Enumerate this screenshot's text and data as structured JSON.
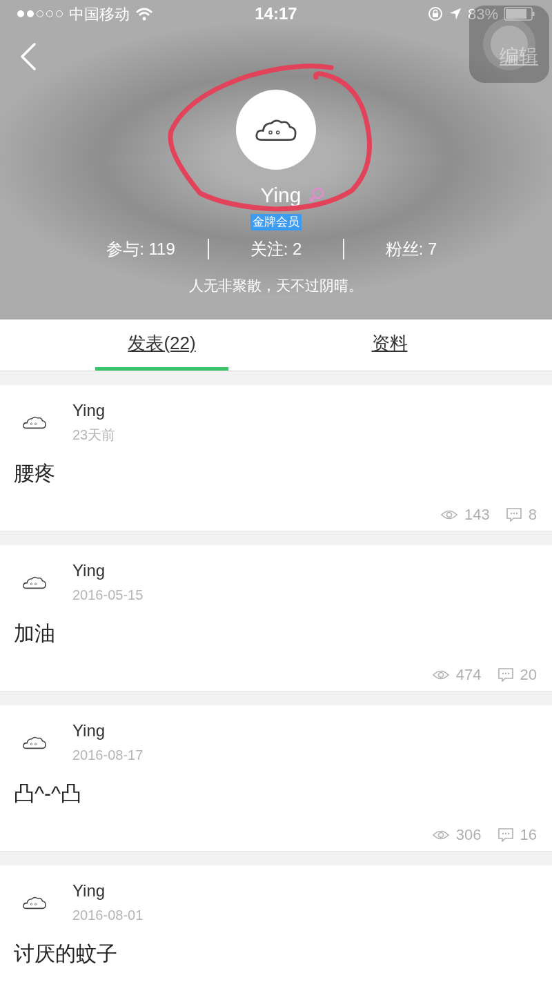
{
  "status_bar": {
    "carrier": "中国移动",
    "time": "14:17",
    "battery": "83%"
  },
  "header": {
    "edit": "编辑",
    "name": "Ying",
    "badge": "金牌会员",
    "motto": "人无非聚散，天不过阴晴。",
    "stats": [
      {
        "label": "参与: 119"
      },
      {
        "label": "关注: 2"
      },
      {
        "label": "粉丝: 7"
      }
    ]
  },
  "tabs": [
    {
      "label": "发表(22)",
      "selected": true
    },
    {
      "label": "资料",
      "selected": false
    }
  ],
  "posts": [
    {
      "author": "Ying",
      "time": "23天前",
      "content": "腰疼",
      "views": "143",
      "comments": "8"
    },
    {
      "author": "Ying",
      "time": "2016-05-15",
      "content": "加油",
      "views": "474",
      "comments": "20"
    },
    {
      "author": "Ying",
      "time": "2016-08-17",
      "content": "凸^-^凸",
      "views": "306",
      "comments": "16"
    },
    {
      "author": "Ying",
      "time": "2016-08-01",
      "content": "讨厌的蚊子"
    }
  ]
}
